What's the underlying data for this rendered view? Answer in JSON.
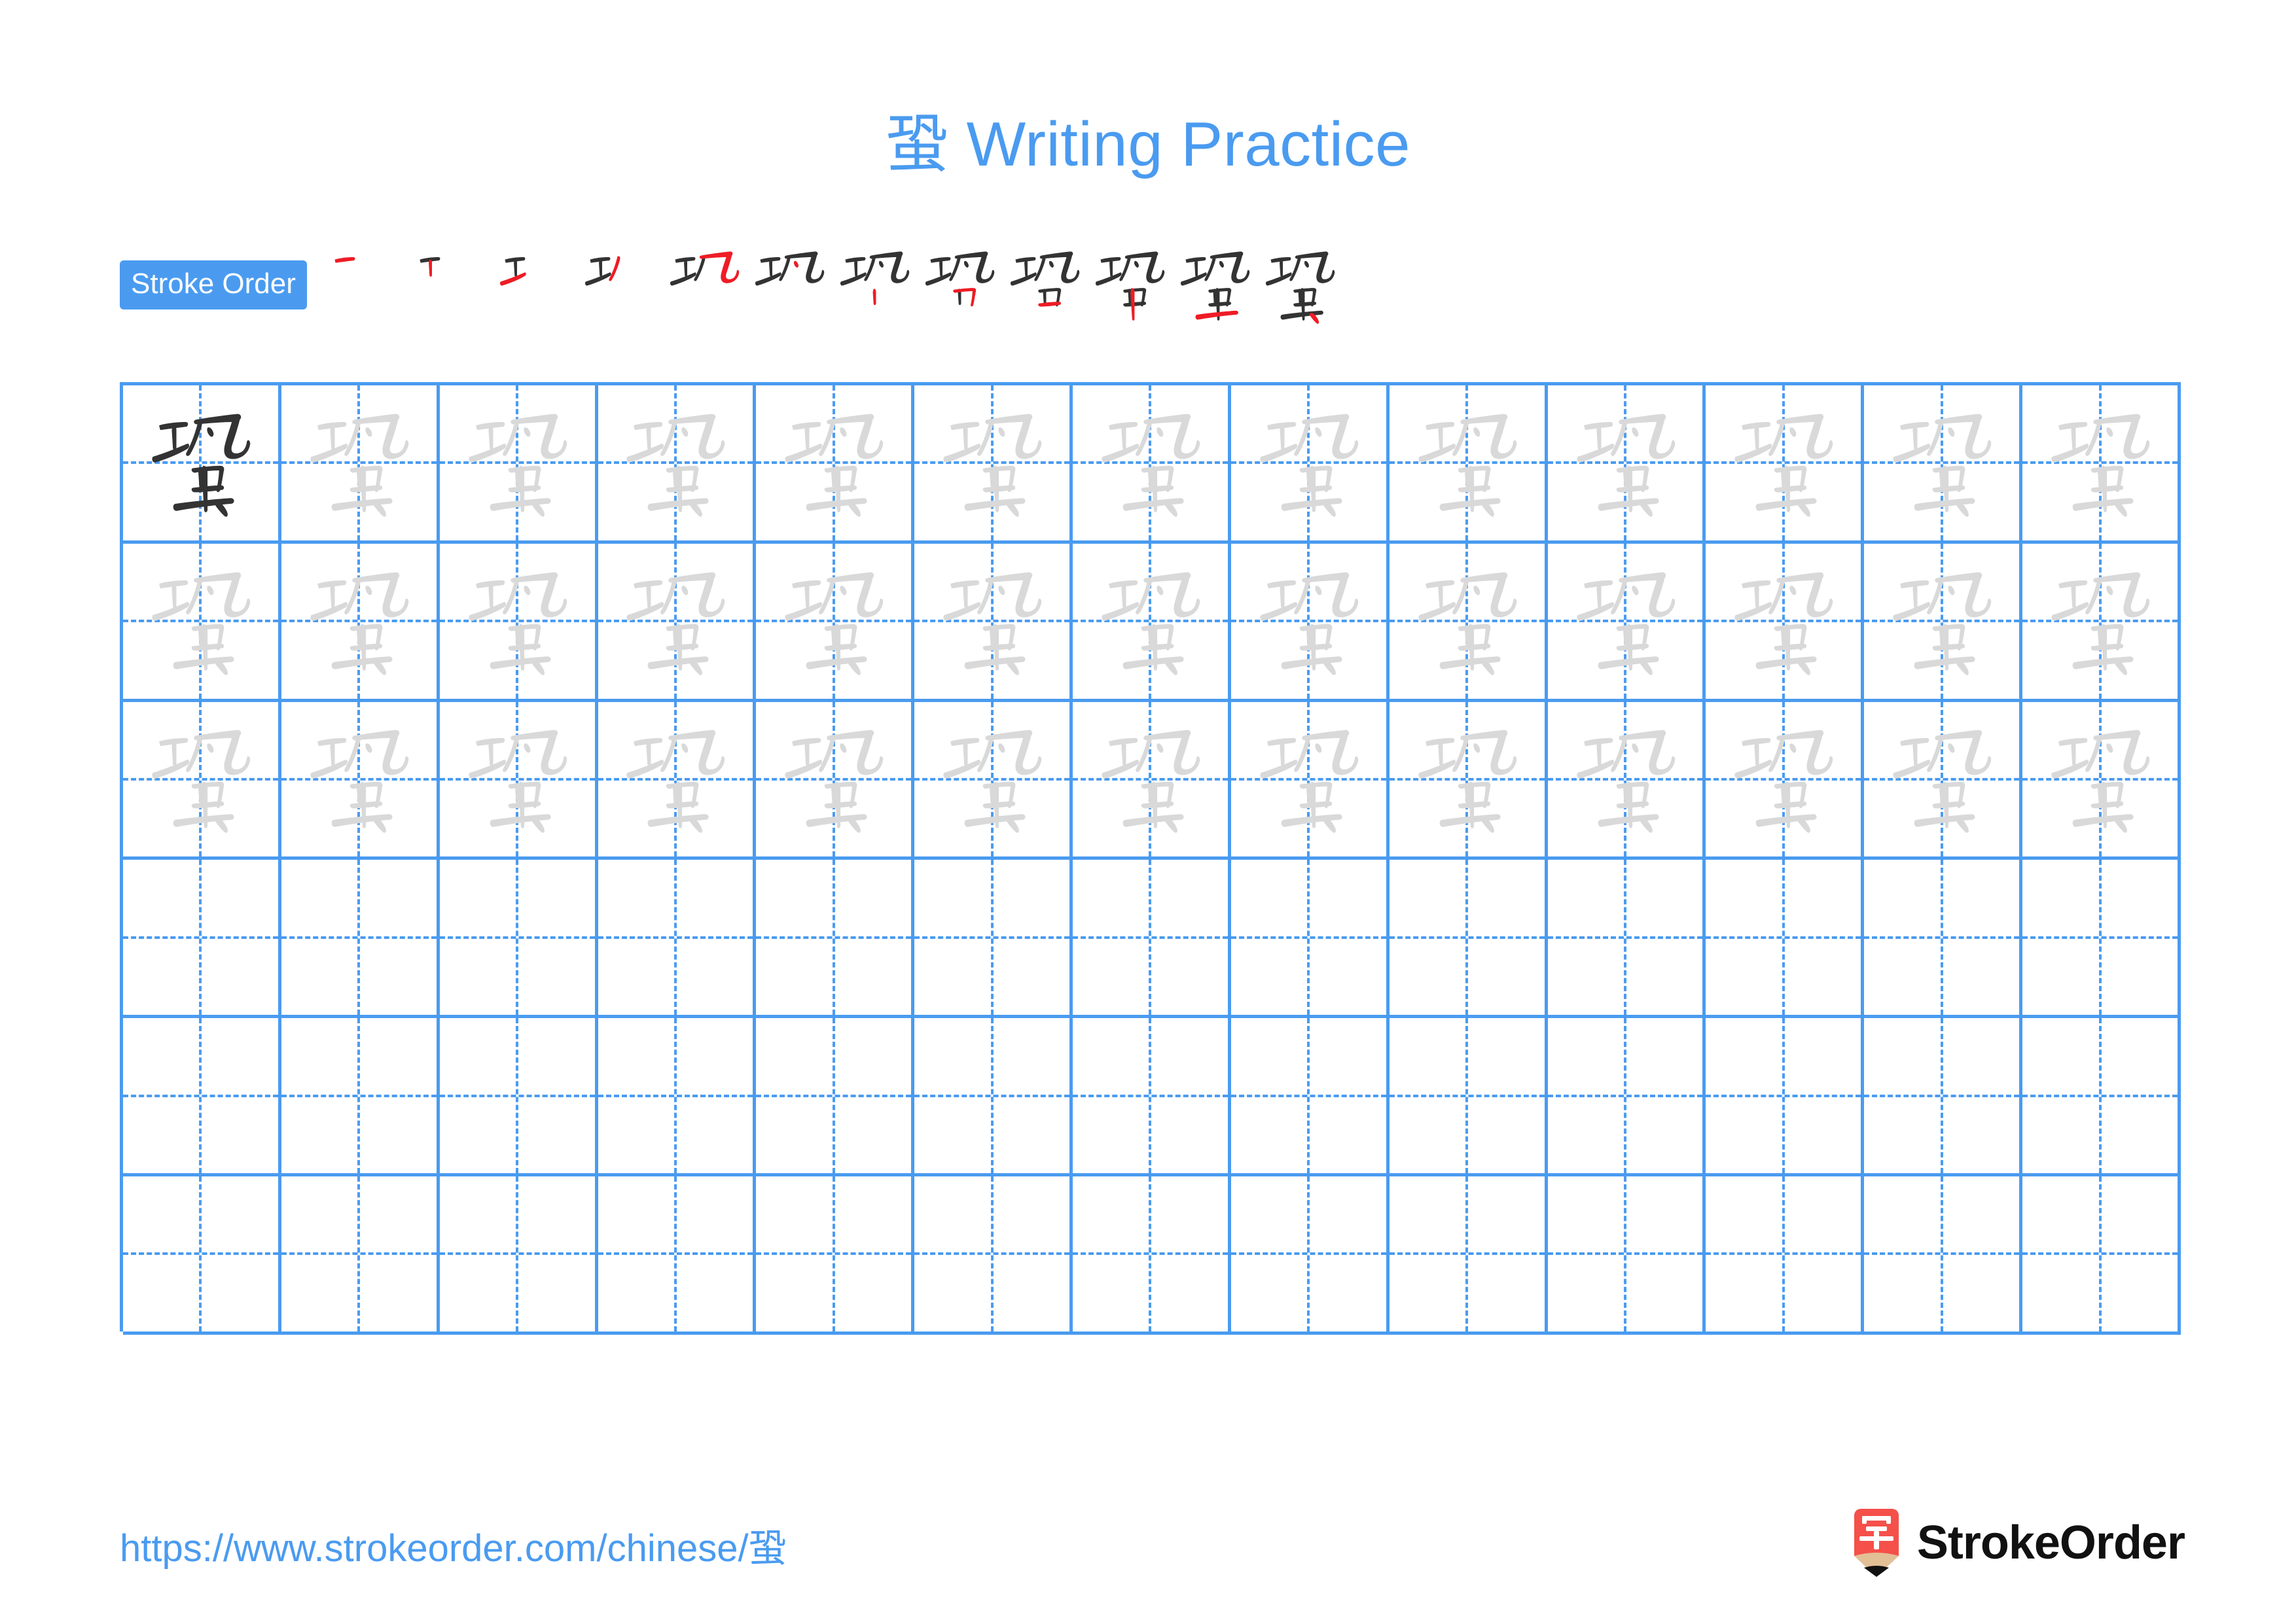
{
  "page": {
    "character": "蛩",
    "title_suffix": " Writing Practice",
    "title_full": "蛩 Writing Practice",
    "background_color": "#ffffff"
  },
  "colors": {
    "accent_blue": "#4a9bf0",
    "grid_line": "#4a9bf0",
    "trace_gray": "#d9d9d9",
    "model_black": "#333333",
    "new_stroke_red": "#ee1c25",
    "brand_red": "#f5504a",
    "brand_tan": "#e3bf96",
    "brand_text": "#111111"
  },
  "stroke_order": {
    "badge_label": "Stroke Order",
    "total_strokes": 12,
    "steps": [
      {
        "index": 1,
        "name": "stroke-step-1",
        "new_stroke": "heng"
      },
      {
        "index": 2,
        "name": "stroke-step-2",
        "new_stroke": "shu"
      },
      {
        "index": 3,
        "name": "stroke-step-3",
        "new_stroke": "tiheng"
      },
      {
        "index": 4,
        "name": "stroke-step-4",
        "new_stroke": "piezhe"
      },
      {
        "index": 5,
        "name": "stroke-step-5",
        "new_stroke": "henggou"
      },
      {
        "index": 6,
        "name": "stroke-step-6",
        "new_stroke": "dian"
      },
      {
        "index": 7,
        "name": "stroke-step-7",
        "new_stroke": "shu"
      },
      {
        "index": 8,
        "name": "stroke-step-8",
        "new_stroke": "hengzhe"
      },
      {
        "index": 9,
        "name": "stroke-step-9",
        "new_stroke": "heng"
      },
      {
        "index": 10,
        "name": "stroke-step-10",
        "new_stroke": "shu"
      },
      {
        "index": 11,
        "name": "stroke-step-11",
        "new_stroke": "heng"
      },
      {
        "index": 12,
        "name": "stroke-step-12",
        "new_stroke": "dian"
      }
    ]
  },
  "practice_grid": {
    "columns": 13,
    "rows": 6,
    "filled_rows": 3,
    "empty_rows": 3,
    "model_cell": {
      "row": 1,
      "column": 1,
      "style": "model-dark"
    },
    "trace_cells_per_filled_row": 12,
    "cell_glyph": "蛩"
  },
  "footer": {
    "url": "https://www.strokeorder.com/chinese/蛩",
    "brand_name": "StrokeOrder",
    "brand_mark_char": "字"
  }
}
